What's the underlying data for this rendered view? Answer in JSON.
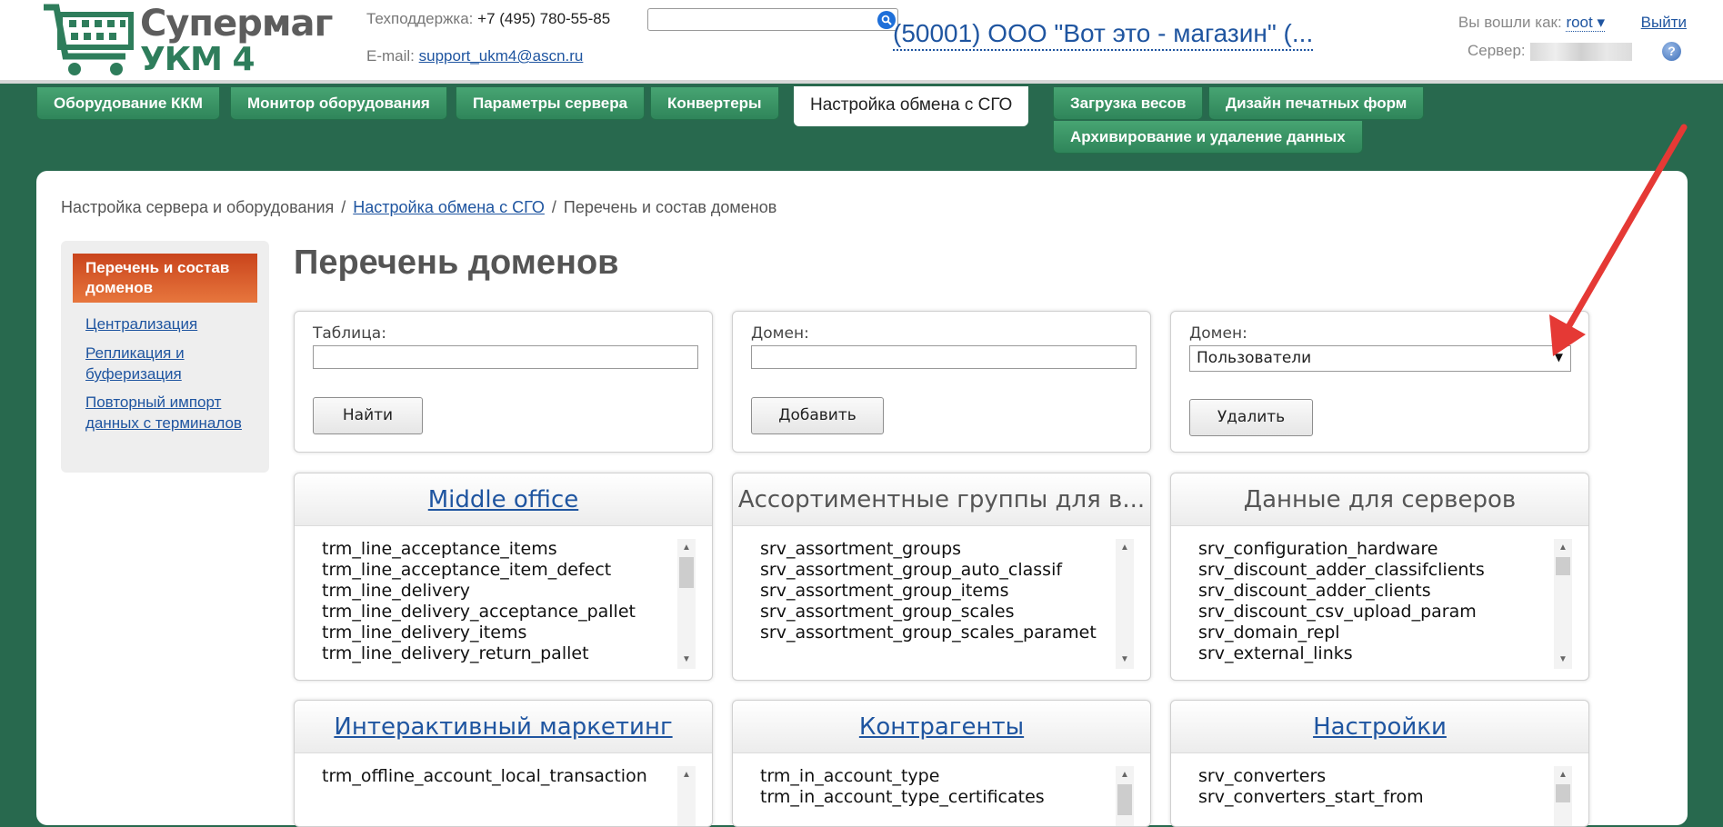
{
  "header": {
    "logo_line1": "Супермаг",
    "logo_line2": "УКМ 4",
    "support_label": "Техподдержка:",
    "support_phone": "+7 (495) 780-55-85",
    "email_label": "E-mail:",
    "email": "support_ukm4@ascn.ru",
    "search_value": "",
    "org_title": "(50001) ООО \"Вот это - магазин\" (...",
    "logged_in_label": "Вы вошли как:",
    "user": "root ▾",
    "logout": "Выйти",
    "server_label": "Сервер:",
    "help": "?"
  },
  "tabs": [
    {
      "label": "Оборудование ККМ"
    },
    {
      "label": "Монитор оборудования"
    },
    {
      "label": "Параметры сервера"
    },
    {
      "label": "Конвертеры"
    },
    {
      "label": "Настройка обмена с СГО",
      "active": true
    },
    {
      "label": "Загрузка весов"
    },
    {
      "label": "Дизайн печатных форм"
    },
    {
      "label": "Архивирование и удаление данных"
    }
  ],
  "breadcrumb": {
    "root": "Настройка сервера и оборудования",
    "sep": "/",
    "parent": "Настройка обмена с СГО",
    "current": "Перечень и состав доменов"
  },
  "sidebar": {
    "active": "Перечень и состав доменов",
    "links": [
      "Централизация",
      "Репликация и буферизация",
      "Повторный импорт данных с терминалов"
    ]
  },
  "main": {
    "title": "Перечень доменов",
    "find_form": {
      "label": "Таблица:",
      "value": "",
      "button": "Найти"
    },
    "add_form": {
      "label": "Домен:",
      "value": "",
      "button": "Добавить"
    },
    "delete_form": {
      "label": "Домен:",
      "selected": "Пользователи",
      "button": "Удалить"
    }
  },
  "cards": [
    {
      "title": "Middle office",
      "link": true,
      "items": [
        "trm_line_acceptance_items",
        "trm_line_acceptance_item_defect",
        "trm_line_delivery",
        "trm_line_delivery_acceptance_pallet",
        "trm_line_delivery_items",
        "trm_line_delivery_return_pallet"
      ]
    },
    {
      "title": "Ассортиментные группы для в...",
      "link": false,
      "items": [
        "srv_assortment_groups",
        "srv_assortment_group_auto_classif",
        "srv_assortment_group_items",
        "srv_assortment_group_scales",
        "srv_assortment_group_scales_paramet"
      ]
    },
    {
      "title": "Данные для серверов",
      "link": false,
      "items": [
        "srv_configuration_hardware",
        "srv_discount_adder_classifclients",
        "srv_discount_adder_clients",
        "srv_discount_csv_upload_param",
        "srv_domain_repl",
        "srv_external_links"
      ]
    },
    {
      "title": "Интерактивный маркетинг",
      "link": true,
      "items": [
        "trm_offline_account_local_transaction"
      ]
    },
    {
      "title": "Контрагенты",
      "link": true,
      "items": [
        "trm_in_account_type",
        "trm_in_account_type_certificates"
      ]
    },
    {
      "title": "Настройки",
      "link": true,
      "items": [
        "srv_converters",
        "srv_converters_start_from"
      ]
    }
  ],
  "colors": {
    "brand_green": "#28694e",
    "tab_green": "#3a9465",
    "link_blue": "#1f55a0",
    "active_orange": "#d9592a",
    "annotation_red": "#e53935"
  }
}
